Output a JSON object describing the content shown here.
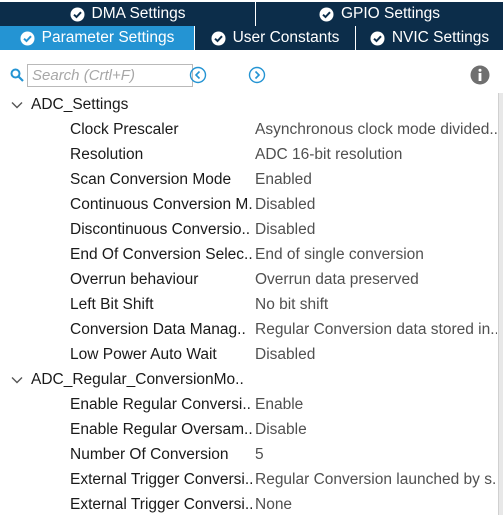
{
  "tabs": {
    "row1": [
      {
        "label": "DMA Settings",
        "icon": "check-circle-icon",
        "active": false
      },
      {
        "label": "GPIO Settings",
        "icon": "check-circle-icon",
        "active": false
      }
    ],
    "row2": [
      {
        "label": "Parameter Settings",
        "icon": "check-circle-icon",
        "active": true
      },
      {
        "label": "User Constants",
        "icon": "check-circle-icon",
        "active": false
      },
      {
        "label": "NVIC Settings",
        "icon": "check-circle-icon",
        "active": false
      }
    ]
  },
  "toolbar": {
    "search_placeholder": "Search (Crtl+F)",
    "prev_icon": "chevron-left-circle-icon",
    "next_icon": "chevron-right-circle-icon",
    "info_icon": "info-icon"
  },
  "groups": [
    {
      "label": "ADC_Settings",
      "expanded": true,
      "params": [
        {
          "name": "Clock Prescaler",
          "value": "Asynchronous clock mode divided.."
        },
        {
          "name": "Resolution",
          "value": "ADC 16-bit resolution"
        },
        {
          "name": "Scan Conversion Mode",
          "value": "Enabled"
        },
        {
          "name": "Continuous Conversion M..",
          "value": "Disabled"
        },
        {
          "name": "Discontinuous Conversio..",
          "value": "Disabled"
        },
        {
          "name": "End Of Conversion Selec..",
          "value": "End of single conversion"
        },
        {
          "name": "Overrun behaviour",
          "value": "Overrun data preserved"
        },
        {
          "name": "Left Bit Shift",
          "value": "No bit shift"
        },
        {
          "name": "Conversion Data Manag..",
          "value": "Regular Conversion data stored in.."
        },
        {
          "name": "Low Power Auto Wait",
          "value": "Disabled"
        }
      ]
    },
    {
      "label": "ADC_Regular_ConversionMo..",
      "expanded": true,
      "params": [
        {
          "name": "Enable Regular Conversi..",
          "value": "Enable"
        },
        {
          "name": "Enable Regular Oversam..",
          "value": "Disable"
        },
        {
          "name": "Number Of Conversion",
          "value": "5"
        },
        {
          "name": "External Trigger Conversi..",
          "value": "Regular Conversion launched by s.."
        },
        {
          "name": "External Trigger Conversi..",
          "value": "None"
        }
      ]
    }
  ],
  "colors": {
    "tab_dark": "#0c2d4a",
    "tab_active": "#2494d3",
    "accent_icon": "#2494d3"
  }
}
